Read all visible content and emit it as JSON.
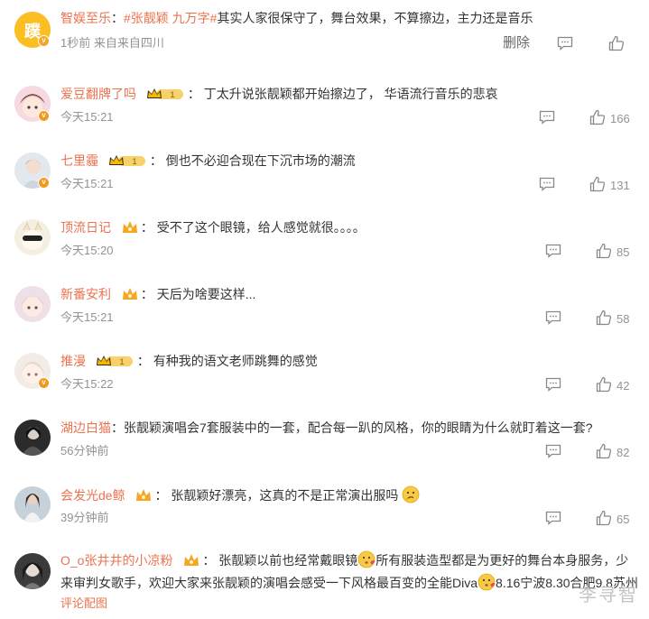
{
  "post": {
    "username": "智娱至乐",
    "colon": "：",
    "topic": "#张靓颖 九万字#",
    "text": "其实人家很保守了，舞台效果，不算擦边，主力还是音乐",
    "meta": "1秒前 来自来自四川",
    "delete_label": "删除",
    "avatar_glyph": "蹼"
  },
  "comments": [
    {
      "username": "爱豆翻牌了吗",
      "text": "丁太升说张靓颖都开始擦边了， 华语流行音乐的悲哀",
      "time": "今天15:21",
      "likes": "166",
      "badge": "crown-level-1"
    },
    {
      "username": "七里霾",
      "text": "倒也不必迎合现在下沉市场的潮流",
      "time": "今天15:21",
      "likes": "131",
      "badge": "crown-level-1"
    },
    {
      "username": "顶流日记",
      "text": "受不了这个眼镜，给人感觉就很。。。。",
      "time": "今天15:20",
      "likes": "85",
      "badge": "small-crown"
    },
    {
      "username": "新番安利",
      "text": "天后为啥要这样...",
      "time": "今天15:21",
      "likes": "58",
      "badge": "small-crown"
    },
    {
      "username": "推漫",
      "text": "有种我的语文老师跳舞的感觉",
      "time": "今天15:22",
      "likes": "42",
      "badge": "crown-level-1"
    },
    {
      "username": "湖边白猫",
      "text": "张靓颖演唱会7套服装中的一套，配合每一趴的风格，你的眼睛为什么就盯着这一套?",
      "time": "56分钟前",
      "likes": "82",
      "badge": "none"
    },
    {
      "username": "会发光de鲸",
      "text": "张靓颖好漂亮，这真的不是正常演出服吗",
      "time": "39分钟前",
      "likes": "65",
      "badge": "small-crown"
    },
    {
      "username": "O_o张井井的小凉粉",
      "text_a": "张靓颖以前也经常戴眼镜",
      "text_b": "所有服装造型都是为更好的舞台本身服务，少来审判女歌手，欢迎大家来张靓颖的演唱会感受一下风格最百变的全能Diva",
      "text_c": "8.16宁波8.30合肥9.8苏州",
      "link": "评论配图",
      "badge": "small-crown"
    }
  ],
  "colon": "：",
  "badge_level": "1",
  "vip_mark": "v",
  "watermark": "李寻智",
  "colors": {
    "username": "#eb7350",
    "text": "#333333",
    "meta": "#939393",
    "badge": "#f39a1e"
  }
}
